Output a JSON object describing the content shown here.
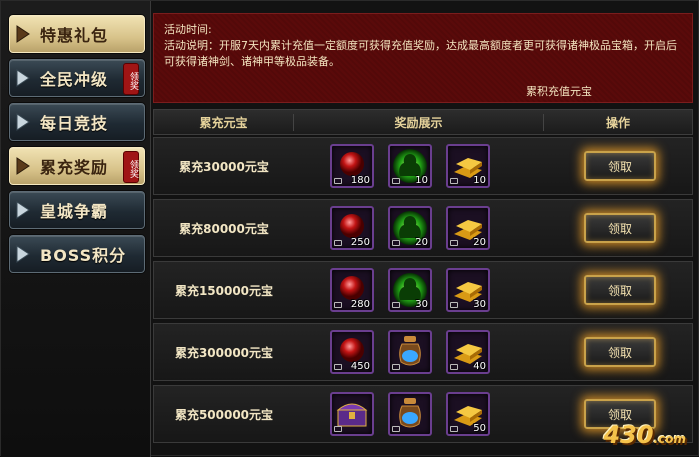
{
  "sidebar": {
    "items": [
      {
        "label": "特惠礼包",
        "active": true,
        "badge": ""
      },
      {
        "label": "全民冲级",
        "active": false,
        "badge": "领奖"
      },
      {
        "label": "每日竞技",
        "active": false,
        "badge": ""
      },
      {
        "label": "累充奖励",
        "active": true,
        "badge": "领奖"
      },
      {
        "label": "皇城争霸",
        "active": false,
        "badge": ""
      },
      {
        "label": "BOSS积分",
        "active": false,
        "badge": ""
      }
    ]
  },
  "info": {
    "time_label": "活动时间:",
    "desc": "活动说明：开服7天内累计充值一定额度可获得充值奖励，达成最高额度者更可获得诸神极品宝箱，开启后可获得诸神剑、诸神甲等极品装备。",
    "total_label": "累积充值元宝"
  },
  "table": {
    "headers": [
      "累充元宝",
      "奖励展示",
      "操作"
    ]
  },
  "rows": [
    {
      "amount": "累充30000元宝",
      "rewards": [
        {
          "icon": "red-orb-icon",
          "qty": "180"
        },
        {
          "icon": "green-spirit-icon",
          "qty": "10"
        },
        {
          "icon": "gold-bars-icon",
          "qty": "10"
        }
      ],
      "button": "领取"
    },
    {
      "amount": "累充80000元宝",
      "rewards": [
        {
          "icon": "red-orb-icon",
          "qty": "250"
        },
        {
          "icon": "green-spirit-icon",
          "qty": "20"
        },
        {
          "icon": "gold-bars-icon",
          "qty": "20"
        }
      ],
      "button": "领取"
    },
    {
      "amount": "累充150000元宝",
      "rewards": [
        {
          "icon": "red-orb-icon",
          "qty": "280"
        },
        {
          "icon": "green-spirit-icon",
          "qty": "30"
        },
        {
          "icon": "gold-bars-icon",
          "qty": "30"
        }
      ],
      "button": "领取"
    },
    {
      "amount": "累充300000元宝",
      "rewards": [
        {
          "icon": "red-orb-icon",
          "qty": "450"
        },
        {
          "icon": "blue-potion-jar-icon",
          "qty": ""
        },
        {
          "icon": "gold-bars-icon",
          "qty": "40"
        }
      ],
      "button": "领取"
    },
    {
      "amount": "累充500000元宝",
      "rewards": [
        {
          "icon": "treasure-chest-icon",
          "qty": ""
        },
        {
          "icon": "blue-potion-jar-icon",
          "qty": ""
        },
        {
          "icon": "gold-bars-icon",
          "qty": "50"
        }
      ],
      "button": "领取"
    }
  ],
  "watermark": {
    "text": "430",
    "suffix": ".com"
  }
}
